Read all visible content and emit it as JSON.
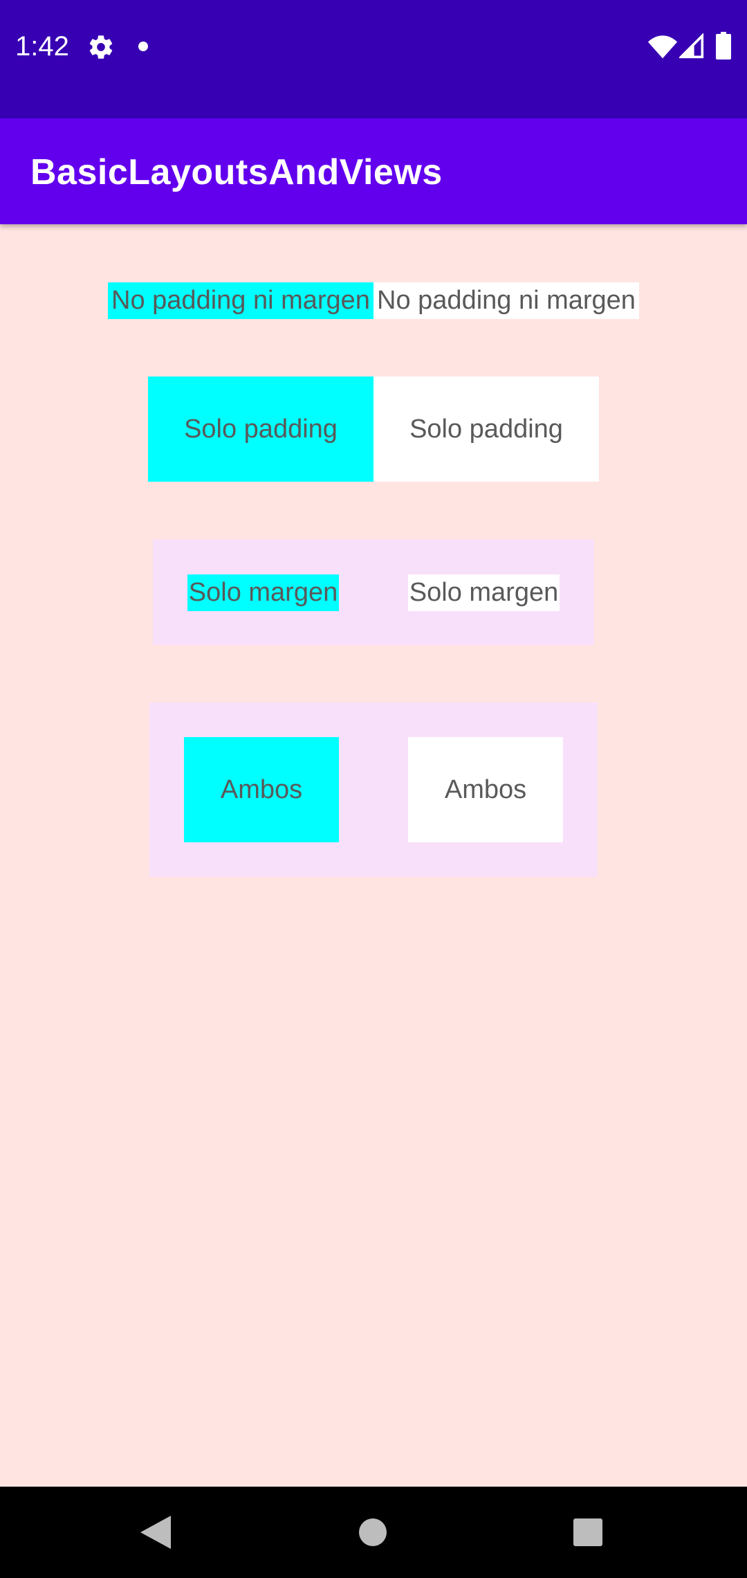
{
  "status_bar": {
    "time": "1:42",
    "icons": [
      "gear-icon",
      "notification-dot-icon",
      "wifi-icon",
      "cell-signal-icon",
      "battery-icon"
    ]
  },
  "app_bar": {
    "title": "BasicLayoutsAndViews"
  },
  "rows": {
    "no_padding_no_margin": {
      "left_label": "No padding ni margen",
      "right_label": "No padding ni margen"
    },
    "padding_only": {
      "left_label": "Solo padding",
      "right_label": "Solo padding"
    },
    "margin_only": {
      "left_label": "Solo margen",
      "right_label": "Solo margen"
    },
    "both": {
      "left_label": "Ambos",
      "right_label": "Ambos"
    }
  },
  "colors": {
    "status_bar": "#3700b3",
    "app_bar": "#6200ee",
    "background": "#ffe4e1",
    "left_view": "#00ffff",
    "right_view": "#ffffff",
    "container": "#f8e0fa"
  },
  "nav_bar": {
    "icons": [
      "back-icon",
      "home-icon",
      "recents-icon"
    ]
  }
}
